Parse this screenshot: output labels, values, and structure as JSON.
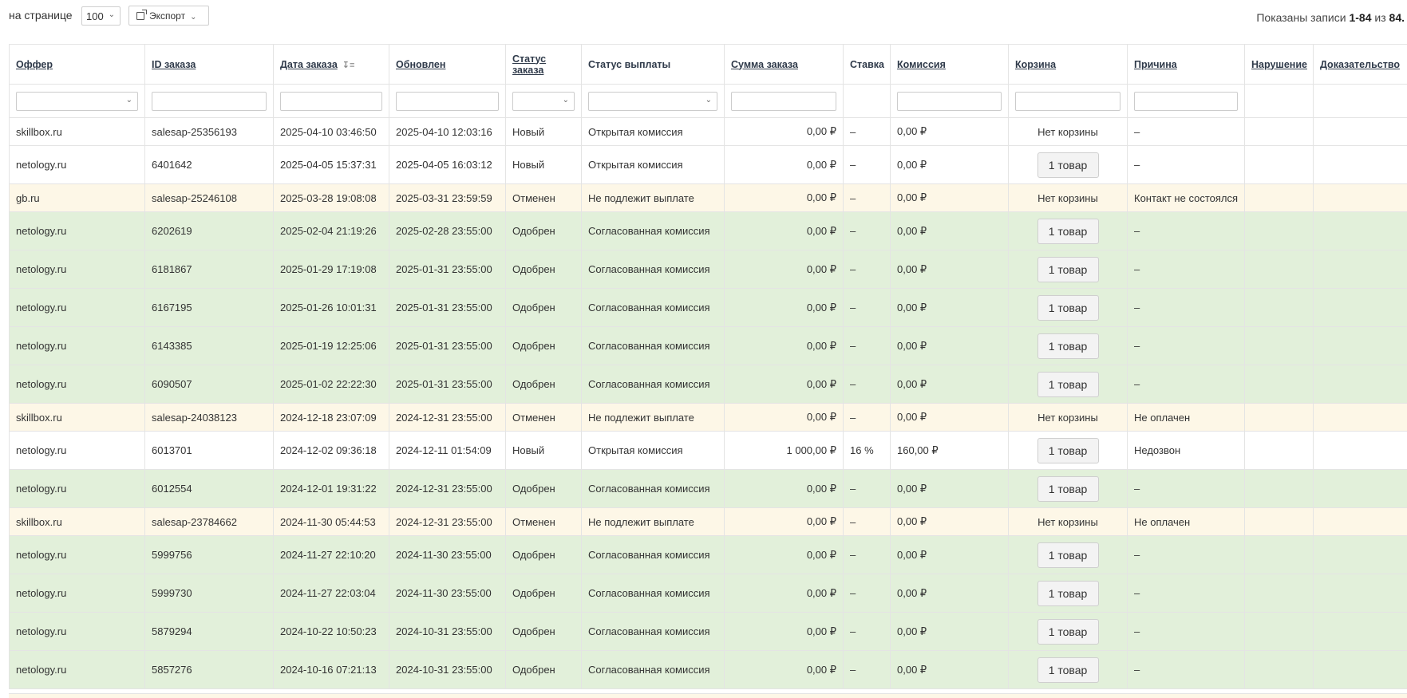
{
  "toolbar": {
    "per_page_label": "на странице",
    "per_page_value": "100",
    "export_label": "Экспорт",
    "summary_prefix": "Показаны записи ",
    "summary_range": "1-84",
    "summary_middle": " из ",
    "summary_total": "84",
    "summary_suffix": "."
  },
  "columns": {
    "offer": "Оффер",
    "order_id": "ID заказа",
    "order_date": "Дата заказа",
    "updated": "Обновлен",
    "order_status": "Статус заказа",
    "payout_status": "Статус выплаты",
    "order_sum": "Сумма заказа",
    "rate": "Ставка",
    "commission": "Комиссия",
    "cart": "Корзина",
    "reason": "Причина",
    "violation": "Нарушение",
    "proof": "Доказательство"
  },
  "colors": {
    "row_new": "#ffffff",
    "row_approved": "#e2f0da",
    "row_cancelled": "#fdf7e7",
    "dash": "#dd4444"
  },
  "rows": [
    {
      "offer": "skillbox.ru",
      "id": "salesap-25356193",
      "date": "2025-04-10 03:46:50",
      "updated": "2025-04-10 12:03:16",
      "status": "Новый",
      "payout": "Открытая комиссия",
      "sum": "0,00 ₽",
      "rate": "–",
      "commission": "0,00 ₽",
      "cart": "Нет корзины",
      "reason": "–",
      "violation": "",
      "proof": ""
    },
    {
      "offer": "netology.ru",
      "id": "6401642",
      "date": "2025-04-05 15:37:31",
      "updated": "2025-04-05 16:03:12",
      "status": "Новый",
      "payout": "Открытая комиссия",
      "sum": "0,00 ₽",
      "rate": "–",
      "commission": "0,00 ₽",
      "cart": "1 товар",
      "reason": "–",
      "violation": "",
      "proof": ""
    },
    {
      "offer": "gb.ru",
      "id": "salesap-25246108",
      "date": "2025-03-28 19:08:08",
      "updated": "2025-03-31 23:59:59",
      "status": "Отменен",
      "payout": "Не подлежит выплате",
      "sum": "0,00 ₽",
      "rate": "–",
      "commission": "0,00 ₽",
      "cart": "Нет корзины",
      "reason": "Контакт не состоялся",
      "violation": "",
      "proof": ""
    },
    {
      "offer": "netology.ru",
      "id": "6202619",
      "date": "2025-02-04 21:19:26",
      "updated": "2025-02-28 23:55:00",
      "status": "Одобрен",
      "payout": "Согласованная комиссия",
      "sum": "0,00 ₽",
      "rate": "–",
      "commission": "0,00 ₽",
      "cart": "1 товар",
      "reason": "–",
      "violation": "",
      "proof": ""
    },
    {
      "offer": "netology.ru",
      "id": "6181867",
      "date": "2025-01-29 17:19:08",
      "updated": "2025-01-31 23:55:00",
      "status": "Одобрен",
      "payout": "Согласованная комиссия",
      "sum": "0,00 ₽",
      "rate": "–",
      "commission": "0,00 ₽",
      "cart": "1 товар",
      "reason": "–",
      "violation": "",
      "proof": ""
    },
    {
      "offer": "netology.ru",
      "id": "6167195",
      "date": "2025-01-26 10:01:31",
      "updated": "2025-01-31 23:55:00",
      "status": "Одобрен",
      "payout": "Согласованная комиссия",
      "sum": "0,00 ₽",
      "rate": "–",
      "commission": "0,00 ₽",
      "cart": "1 товар",
      "reason": "–",
      "violation": "",
      "proof": ""
    },
    {
      "offer": "netology.ru",
      "id": "6143385",
      "date": "2025-01-19 12:25:06",
      "updated": "2025-01-31 23:55:00",
      "status": "Одобрен",
      "payout": "Согласованная комиссия",
      "sum": "0,00 ₽",
      "rate": "–",
      "commission": "0,00 ₽",
      "cart": "1 товар",
      "reason": "–",
      "violation": "",
      "proof": ""
    },
    {
      "offer": "netology.ru",
      "id": "6090507",
      "date": "2025-01-02 22:22:30",
      "updated": "2025-01-31 23:55:00",
      "status": "Одобрен",
      "payout": "Согласованная комиссия",
      "sum": "0,00 ₽",
      "rate": "–",
      "commission": "0,00 ₽",
      "cart": "1 товар",
      "reason": "–",
      "violation": "",
      "proof": ""
    },
    {
      "offer": "skillbox.ru",
      "id": "salesap-24038123",
      "date": "2024-12-18 23:07:09",
      "updated": "2024-12-31 23:55:00",
      "status": "Отменен",
      "payout": "Не подлежит выплате",
      "sum": "0,00 ₽",
      "rate": "–",
      "commission": "0,00 ₽",
      "cart": "Нет корзины",
      "reason": "Не оплачен",
      "violation": "",
      "proof": ""
    },
    {
      "offer": "netology.ru",
      "id": "6013701",
      "date": "2024-12-02 09:36:18",
      "updated": "2024-12-11 01:54:09",
      "status": "Новый",
      "payout": "Открытая комиссия",
      "sum": "1 000,00 ₽",
      "rate": "16 %",
      "commission": "160,00 ₽",
      "cart": "1 товар",
      "reason": "Недозвон",
      "violation": "",
      "proof": ""
    },
    {
      "offer": "netology.ru",
      "id": "6012554",
      "date": "2024-12-01 19:31:22",
      "updated": "2024-12-31 23:55:00",
      "status": "Одобрен",
      "payout": "Согласованная комиссия",
      "sum": "0,00 ₽",
      "rate": "–",
      "commission": "0,00 ₽",
      "cart": "1 товар",
      "reason": "–",
      "violation": "",
      "proof": ""
    },
    {
      "offer": "skillbox.ru",
      "id": "salesap-23784662",
      "date": "2024-11-30 05:44:53",
      "updated": "2024-12-31 23:55:00",
      "status": "Отменен",
      "payout": "Не подлежит выплате",
      "sum": "0,00 ₽",
      "rate": "–",
      "commission": "0,00 ₽",
      "cart": "Нет корзины",
      "reason": "Не оплачен",
      "violation": "",
      "proof": ""
    },
    {
      "offer": "netology.ru",
      "id": "5999756",
      "date": "2024-11-27 22:10:20",
      "updated": "2024-11-30 23:55:00",
      "status": "Одобрен",
      "payout": "Согласованная комиссия",
      "sum": "0,00 ₽",
      "rate": "–",
      "commission": "0,00 ₽",
      "cart": "1 товар",
      "reason": "–",
      "violation": "",
      "proof": ""
    },
    {
      "offer": "netology.ru",
      "id": "5999730",
      "date": "2024-11-27 22:03:04",
      "updated": "2024-11-30 23:55:00",
      "status": "Одобрен",
      "payout": "Согласованная комиссия",
      "sum": "0,00 ₽",
      "rate": "–",
      "commission": "0,00 ₽",
      "cart": "1 товар",
      "reason": "–",
      "violation": "",
      "proof": ""
    },
    {
      "offer": "netology.ru",
      "id": "5879294",
      "date": "2024-10-22 10:50:23",
      "updated": "2024-10-31 23:55:00",
      "status": "Одобрен",
      "payout": "Согласованная комиссия",
      "sum": "0,00 ₽",
      "rate": "–",
      "commission": "0,00 ₽",
      "cart": "1 товар",
      "reason": "–",
      "violation": "",
      "proof": ""
    },
    {
      "offer": "netology.ru",
      "id": "5857276",
      "date": "2024-10-16 07:21:13",
      "updated": "2024-10-31 23:55:00",
      "status": "Одобрен",
      "payout": "Согласованная комиссия",
      "sum": "0,00 ₽",
      "rate": "–",
      "commission": "0,00 ₽",
      "cart": "1 товар",
      "reason": "–",
      "violation": "",
      "proof": ""
    }
  ]
}
